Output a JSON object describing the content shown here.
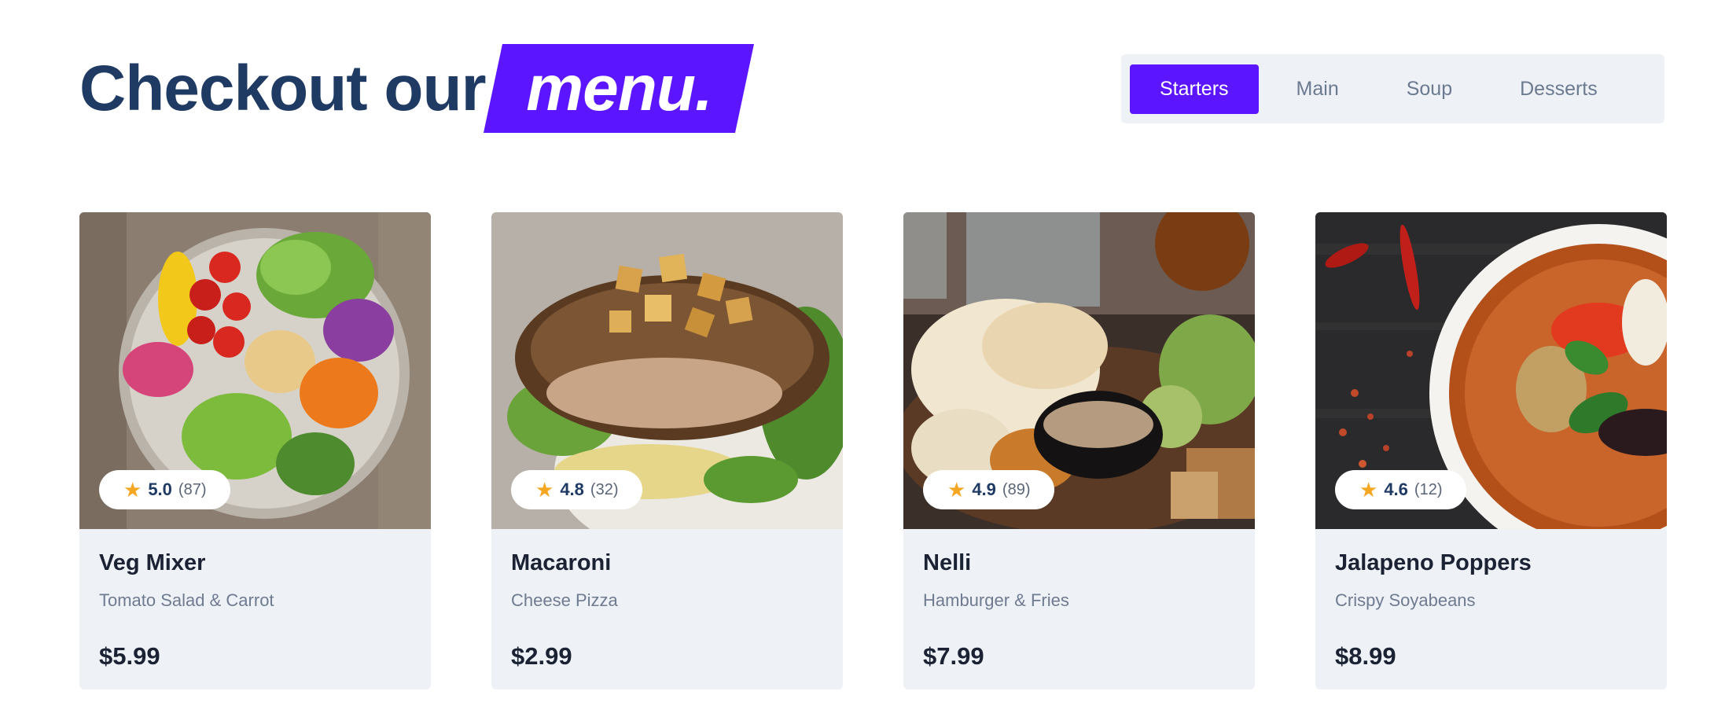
{
  "heading": {
    "text": "Checkout our",
    "accent": "menu."
  },
  "tabs": [
    {
      "label": "Starters",
      "active": true
    },
    {
      "label": "Main",
      "active": false
    },
    {
      "label": "Soup",
      "active": false
    },
    {
      "label": "Desserts",
      "active": false
    }
  ],
  "colors": {
    "accent": "#5b16ff",
    "heading": "#1f3a63",
    "star": "#f5a623",
    "card_bg": "#eef1f6"
  },
  "cards": [
    {
      "name": "Veg Mixer",
      "description": "Tomato Salad & Carrot",
      "price": "$5.99",
      "rating": "5.0",
      "reviews": "(87)",
      "star_icon": "star-icon"
    },
    {
      "name": "Macaroni",
      "description": "Cheese Pizza",
      "price": "$2.99",
      "rating": "4.8",
      "reviews": "(32)",
      "star_icon": "star-icon"
    },
    {
      "name": "Nelli",
      "description": "Hamburger & Fries",
      "price": "$7.99",
      "rating": "4.9",
      "reviews": "(89)",
      "star_icon": "star-icon"
    },
    {
      "name": "Jalapeno Poppers",
      "description": "Crispy Soyabeans",
      "price": "$8.99",
      "rating": "4.6",
      "reviews": "(12)",
      "star_icon": "star-icon"
    }
  ]
}
